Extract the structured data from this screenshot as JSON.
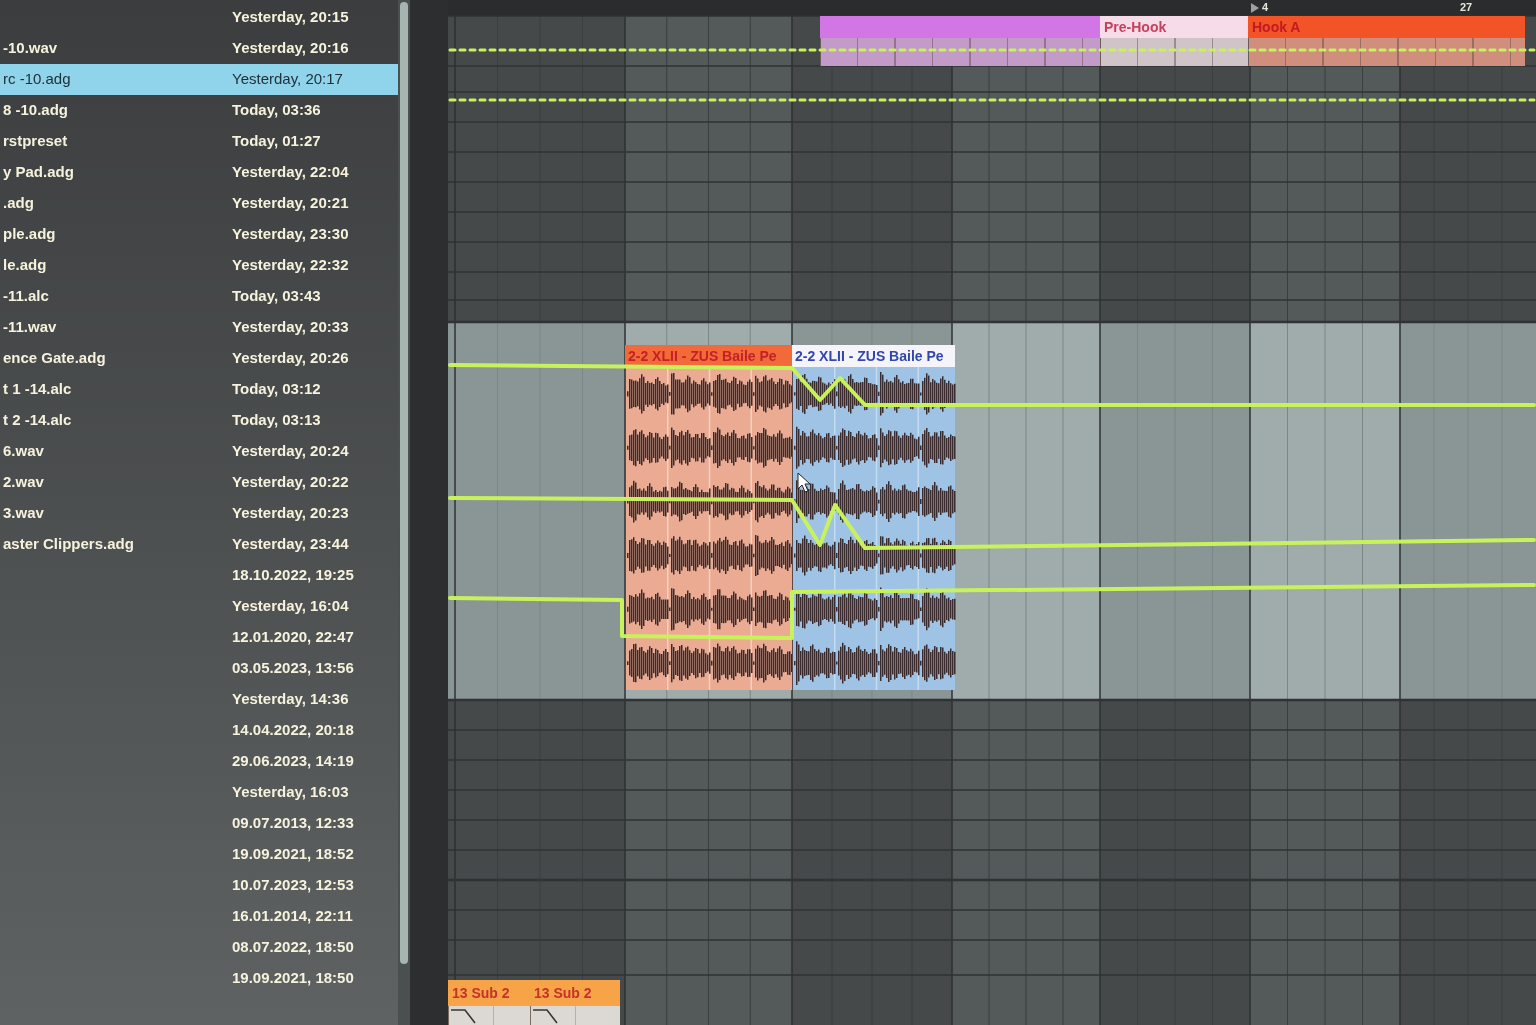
{
  "browser": {
    "rows": [
      {
        "modified": "Yesterday, 20:15",
        "selected": false
      },
      {
        "name": "-10.wav",
        "modified": "Yesterday, 20:16",
        "selected": false
      },
      {
        "name": "rc -10.adg",
        "modified": "Yesterday, 20:17",
        "selected": true
      },
      {
        "name": "8 -10.adg",
        "modified": "Today, 03:36",
        "selected": false
      },
      {
        "name": "rstpreset",
        "modified": "Today, 01:27",
        "selected": false
      },
      {
        "name": "y Pad.adg",
        "modified": "Yesterday, 22:04",
        "selected": false
      },
      {
        "name": ".adg",
        "modified": "Yesterday, 20:21",
        "selected": false
      },
      {
        "name": "ple.adg",
        "modified": "Yesterday, 23:30",
        "selected": false
      },
      {
        "name": "le.adg",
        "modified": "Yesterday, 22:32",
        "selected": false
      },
      {
        "name": "-11.alc",
        "modified": "Today, 03:43",
        "selected": false
      },
      {
        "name": "-11.wav",
        "modified": "Yesterday, 20:33",
        "selected": false
      },
      {
        "name": "ence Gate.adg",
        "modified": "Yesterday, 20:26",
        "selected": false
      },
      {
        "name": "t 1 -14.alc",
        "modified": "Today, 03:12",
        "selected": false
      },
      {
        "name": "t 2 -14.alc",
        "modified": "Today, 03:13",
        "selected": false
      },
      {
        "name": "6.wav",
        "modified": "Yesterday, 20:24",
        "selected": false
      },
      {
        "name": "2.wav",
        "modified": "Yesterday, 20:22",
        "selected": false
      },
      {
        "name": "3.wav",
        "modified": "Yesterday, 20:23",
        "selected": false
      },
      {
        "name": "aster Clippers.adg",
        "modified": "Yesterday, 23:44",
        "selected": false
      },
      {
        "modified": "18.10.2022, 19:25",
        "selected": false
      },
      {
        "modified": "Yesterday, 16:04",
        "selected": false
      },
      {
        "modified": "12.01.2020, 22:47",
        "selected": false
      },
      {
        "modified": "03.05.2023, 13:56",
        "selected": false
      },
      {
        "modified": "Yesterday, 14:36",
        "selected": false
      },
      {
        "modified": "14.04.2022, 20:18",
        "selected": false
      },
      {
        "modified": "29.06.2023, 14:19",
        "selected": false
      },
      {
        "modified": "Yesterday, 16:03",
        "selected": false
      },
      {
        "modified": "09.07.2013, 12:33",
        "selected": false
      },
      {
        "modified": "19.09.2021, 18:52",
        "selected": false
      },
      {
        "modified": "10.07.2023, 12:53",
        "selected": false
      },
      {
        "modified": "16.01.2014, 22:11",
        "selected": false
      },
      {
        "modified": "08.07.2022, 18:50",
        "selected": false
      },
      {
        "modified": "19.09.2021, 18:50",
        "selected": false
      }
    ]
  },
  "arrangement": {
    "ruler_labels": [
      "4",
      "27"
    ],
    "section_clips": [
      {
        "color": "#d276e6"
      },
      {
        "name": "Pre-Hook",
        "color": "#f6dbe9"
      },
      {
        "name": "Hook A",
        "color": "#f25428"
      }
    ],
    "audio_clips": [
      {
        "name": "2-2 XLII - ZUS Baile Pe",
        "color": "#f26a3a",
        "selected": false
      },
      {
        "name": "2-2 XLII - ZUS Baile Pe",
        "selected": true
      }
    ],
    "bottom_clips": [
      {
        "name": "13 Sub 2",
        "color": "#f7a448"
      },
      {
        "name": "13 Sub 2",
        "color": "#f7a448"
      }
    ]
  }
}
